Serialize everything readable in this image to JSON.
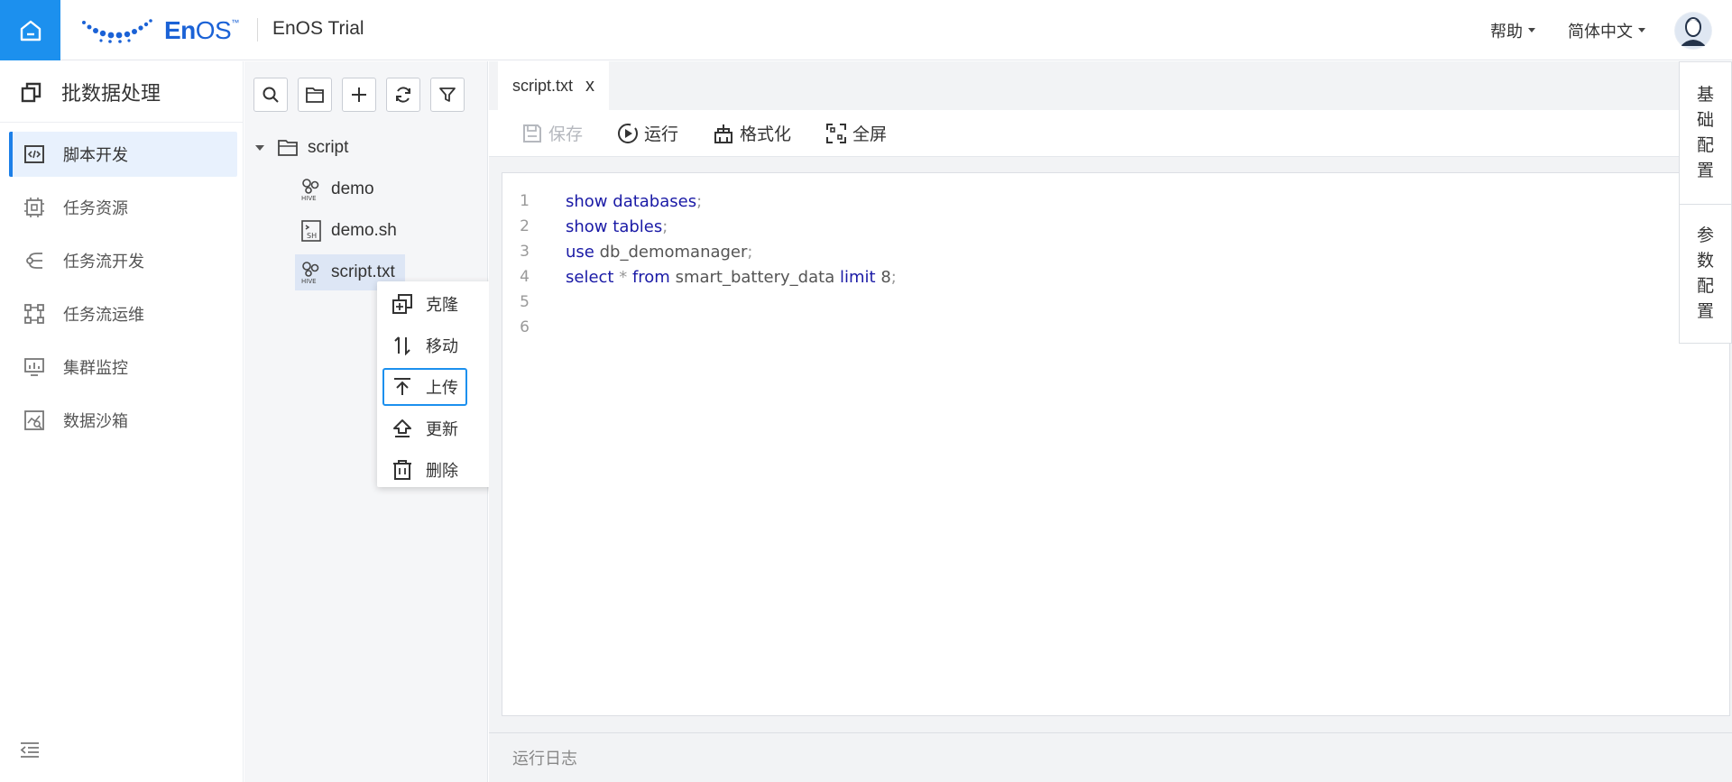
{
  "header": {
    "logo_brand": "En",
    "logo_brand_os": "OS",
    "logo_tm": "™",
    "app_title": "EnOS Trial",
    "help_label": "帮助",
    "language_label": "简体中文"
  },
  "sidebar": {
    "title": "批数据处理",
    "items": [
      {
        "label": "脚本开发",
        "icon": "script-dev-icon",
        "active": true
      },
      {
        "label": "任务资源",
        "icon": "task-resource-icon"
      },
      {
        "label": "任务流开发",
        "icon": "workflow-dev-icon"
      },
      {
        "label": "任务流运维",
        "icon": "workflow-ops-icon"
      },
      {
        "label": "集群监控",
        "icon": "cluster-monitor-icon"
      },
      {
        "label": "数据沙箱",
        "icon": "data-sandbox-icon"
      }
    ]
  },
  "tree": {
    "root": "script",
    "children": [
      {
        "name": "demo",
        "type": "hive"
      },
      {
        "name": "demo.sh",
        "type": "sh"
      },
      {
        "name": "script.txt",
        "type": "hive",
        "selected": true
      }
    ]
  },
  "context_menu": {
    "items": [
      {
        "label": "克隆",
        "icon": "clone-icon"
      },
      {
        "label": "移动",
        "icon": "move-icon"
      },
      {
        "label": "上传",
        "icon": "upload-icon",
        "focused": true
      },
      {
        "label": "更新",
        "icon": "update-icon"
      },
      {
        "label": "删除",
        "icon": "delete-icon"
      }
    ]
  },
  "editor": {
    "tab_label": "script.txt",
    "tab_close": "x",
    "toolbar": {
      "save": "保存",
      "run": "运行",
      "format": "格式化",
      "fullscreen": "全屏"
    },
    "lines": [
      {
        "num": "1",
        "k1": "show",
        "n1": "databases",
        "p": ";"
      },
      {
        "num": "2",
        "k1": "show",
        "n1": "tables",
        "p": ";"
      },
      {
        "num": "3",
        "k1": "use",
        "n1": "db_demomanager",
        "p": ";"
      },
      {
        "num": "4",
        "k1": "select",
        "n1": "*",
        "k2": "from",
        "n2": "smart_battery_data",
        "k3": "limit",
        "n3": "8",
        "p": ";"
      },
      {
        "num": "5"
      },
      {
        "num": "6"
      }
    ],
    "log_label": "运行日志"
  },
  "right_panel": {
    "basic_config": [
      "基",
      "础",
      "配",
      "置"
    ],
    "param_config": [
      "参",
      "数",
      "配",
      "置"
    ]
  },
  "colors": {
    "accent": "#1c90ee",
    "keyword": "#1a1aa6"
  }
}
